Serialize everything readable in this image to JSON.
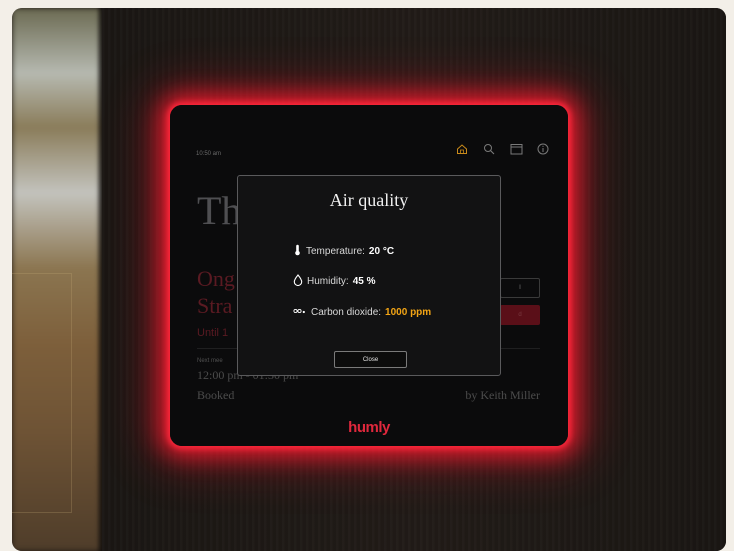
{
  "device": {
    "time": "10:50 am",
    "room_title": "Th",
    "meeting_title": "Ong\nStra",
    "until": "Until 1",
    "side_button_1": "ll",
    "side_button_2": "d",
    "next_label": "Next mee",
    "next_time": "12:00 pm - 01:30 pm",
    "next_status": "Booked",
    "organizer": "by Keith Miller",
    "brand": "humly",
    "icons": [
      "home-icon",
      "search-icon",
      "calendar-icon",
      "info-icon"
    ],
    "colors": {
      "accent": "#e0283c",
      "glow": "#ff2a3c",
      "warning": "#f3a515"
    }
  },
  "modal": {
    "title": "Air quality",
    "temperature_label": "Temperature:",
    "temperature_value": "20 °C",
    "humidity_label": "Humidity:",
    "humidity_value": "45 %",
    "co2_label": "Carbon dioxide:",
    "co2_value": "1000 ppm",
    "close_label": "Close"
  }
}
